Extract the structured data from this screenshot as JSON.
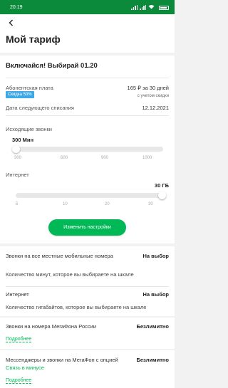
{
  "status_bar": {
    "time": "20:19",
    "battery": ""
  },
  "header": {
    "title": "Мой тариф"
  },
  "tariff": {
    "name": "Включайся! Выбирай 01.20",
    "fee_label": "Абонентская плата",
    "fee_value": "165 ₽ за 30 дней",
    "fee_note": "с учетом скидки",
    "discount_badge": "Скидка 50%",
    "next_charge_label": "Дата следующего списания",
    "next_charge_date": "12.12.2021"
  },
  "calls_slider": {
    "label": "Исходящие звонки",
    "value_text": "300 Мин",
    "level": 0,
    "ticks": [
      "300",
      "600",
      "900",
      "1000"
    ]
  },
  "internet_slider": {
    "label": "Интернет",
    "value_text": "30 ГБ",
    "level": 1,
    "ticks": [
      "5",
      "10",
      "20",
      "30"
    ]
  },
  "change_button": "Изменить настройки",
  "options": {
    "local_calls": {
      "title": "Звонки на все местные мобильные номера",
      "value": "На выбор",
      "desc": "Количество минут, которое вы выбираете на шкале"
    },
    "internet": {
      "title": "Интернет",
      "value": "На выбор",
      "desc": "Количество гигабайтов, которое вы выбираете на шкале"
    },
    "megafon_calls": {
      "title": "Звонки на номера МегаФона России",
      "value": "Безлимитно",
      "link": "Подробнее"
    },
    "messengers": {
      "title": "Мессенджеры и звонки на МегаФон с опцией",
      "subtitle": "Связь в минусе",
      "value": "Безлимитно",
      "link": "Подробнее"
    }
  },
  "colors": {
    "brand_green": "#00b956",
    "status_bar": "#0b8a3c",
    "badge_blue": "#3da8e6"
  }
}
